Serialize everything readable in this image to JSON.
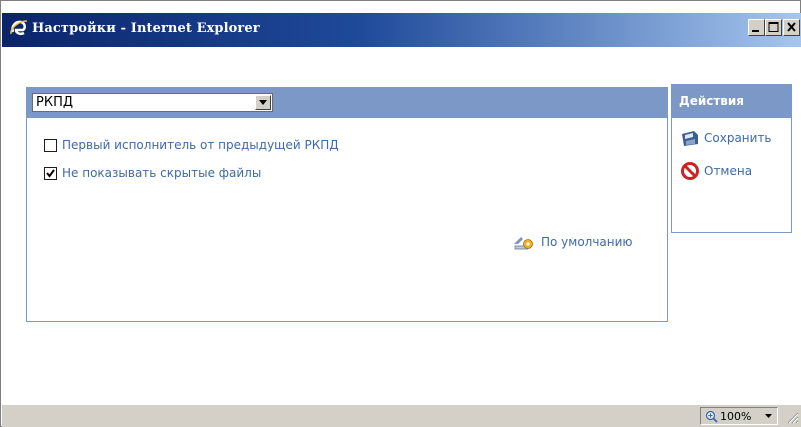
{
  "window": {
    "title": "Настройки - Internet Explorer",
    "title_bar_color": "#0a246a"
  },
  "settings": {
    "select": {
      "value": "РКПД"
    },
    "options": [
      {
        "label": "Первый исполнитель от предыдущей РКПД",
        "checked": false
      },
      {
        "label": "Не показывать скрытые файлы",
        "checked": true
      }
    ],
    "defaults_label": "По умолчанию"
  },
  "actions": {
    "header": "Действия",
    "save_label": "Сохранить",
    "cancel_label": "Отмена"
  },
  "statusbar": {
    "zoom": "100%"
  },
  "colors": {
    "panel_header": "#7b98c6",
    "link_text": "#3e6aa8"
  },
  "icons": [
    "ie-icon",
    "minimize-icon",
    "maximize-icon",
    "close-icon",
    "dropdown-arrow-icon",
    "checkmark-icon",
    "defaults-icon",
    "save-icon",
    "cancel-icon",
    "zoom-icon",
    "resize-grip-icon"
  ]
}
